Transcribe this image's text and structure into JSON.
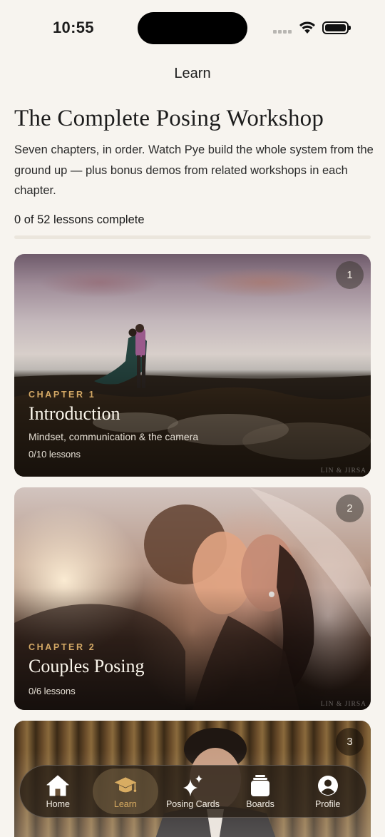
{
  "status_bar": {
    "time": "10:55"
  },
  "nav": {
    "title": "Learn"
  },
  "course": {
    "title": "The Complete Posing Workshop",
    "description": "Seven chapters, in order. Watch Pye build the whole system from the ground up — plus bonus demos from related workshops in each chapter.",
    "progress_text": "0 of 52 lessons complete",
    "progress_fraction": 0
  },
  "chapters": [
    {
      "number": "1",
      "label": "CHAPTER 1",
      "title": "Introduction",
      "subtitle": "Mindset, communication & the camera",
      "lessons": "0/10 lessons",
      "watermark": "LIN & JIRSA"
    },
    {
      "number": "2",
      "label": "CHAPTER 2",
      "title": "Couples Posing",
      "subtitle": "",
      "lessons": "0/6 lessons",
      "watermark": "LIN & JIRSA"
    },
    {
      "number": "3"
    }
  ],
  "tabbar": {
    "items": [
      {
        "label": "Home",
        "icon": "home-icon",
        "active": false
      },
      {
        "label": "Learn",
        "icon": "graduation-cap-icon",
        "active": true
      },
      {
        "label": "Posing Cards",
        "icon": "sparkles-icon",
        "active": false
      },
      {
        "label": "Boards",
        "icon": "boards-icon",
        "active": false
      },
      {
        "label": "Profile",
        "icon": "profile-icon",
        "active": false
      }
    ]
  },
  "colors": {
    "background": "#f7f4ef",
    "accent": "#c9a15d",
    "chapter_label": "#d3a865"
  }
}
